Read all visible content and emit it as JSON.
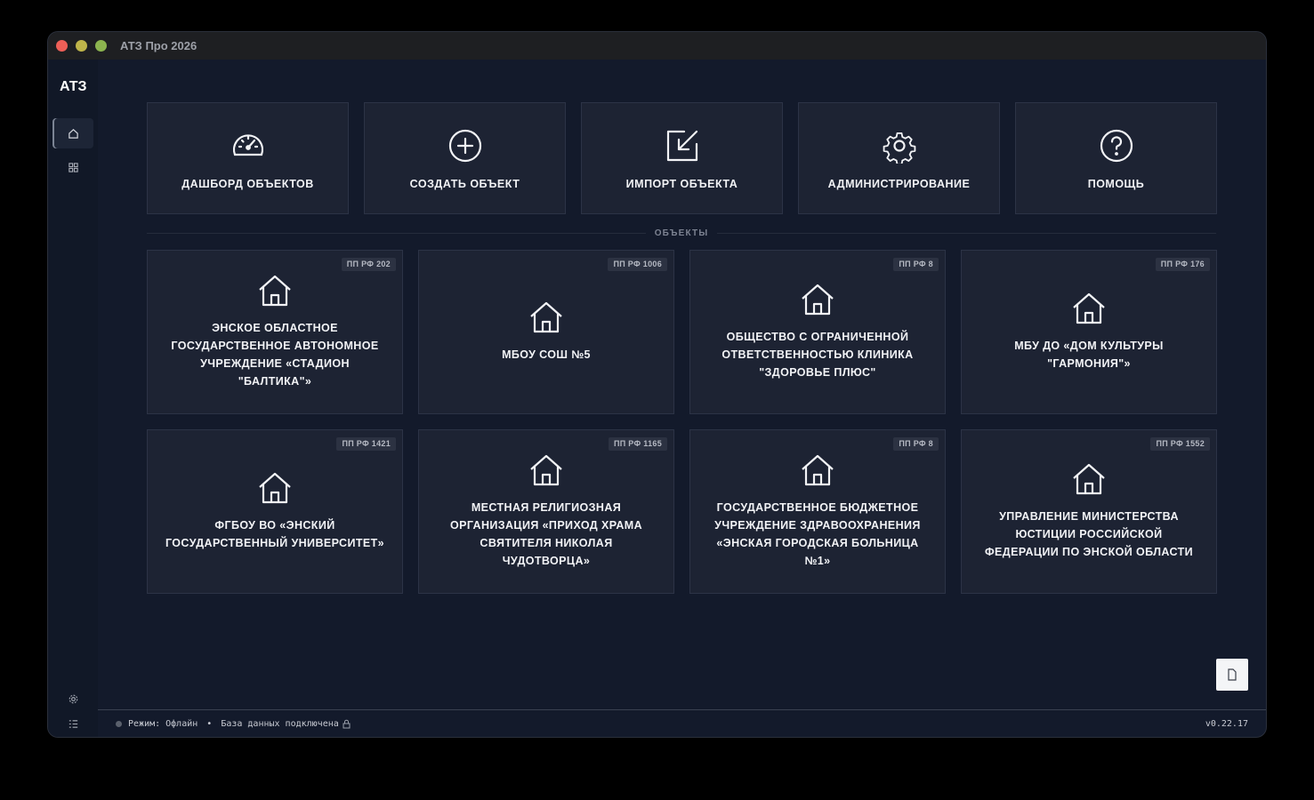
{
  "window": {
    "title": "АТЗ Про 2026"
  },
  "sidebar": {
    "logo": "АТЗ",
    "items": [
      {
        "icon": "home-icon"
      },
      {
        "icon": "grid-icon"
      }
    ],
    "bottom": [
      {
        "icon": "gear-icon"
      },
      {
        "icon": "list-icon"
      }
    ]
  },
  "actions": [
    {
      "label": "ДАШБОРД ОБЪЕКТОВ",
      "icon": "speedometer-icon"
    },
    {
      "label": "СОЗДАТЬ ОБЪЕКТ",
      "icon": "plus-circle-icon"
    },
    {
      "label": "ИМПОРТ ОБЪЕКТА",
      "icon": "import-icon"
    },
    {
      "label": "АДМИНИСТРИРОВАНИЕ",
      "icon": "gear-icon"
    },
    {
      "label": "ПОМОЩЬ",
      "icon": "help-icon"
    }
  ],
  "section_title": "ОБЪЕКТЫ",
  "objects": [
    {
      "badge": "ПП РФ 202",
      "name": "ЭНСКОЕ ОБЛАСТНОЕ ГОСУДАРСТВЕННОЕ АВТОНОМНОЕ УЧРЕЖДЕНИЕ «СТАДИОН \"БАЛТИКА\"»"
    },
    {
      "badge": "ПП РФ 1006",
      "name": "МБОУ СОШ №5"
    },
    {
      "badge": "ПП РФ 8",
      "name": "ОБЩЕСТВО С ОГРАНИЧЕННОЙ ОТВЕТСТВЕННОСТЬЮ КЛИНИКА \"ЗДОРОВЬЕ ПЛЮС\""
    },
    {
      "badge": "ПП РФ 176",
      "name": "МБУ ДО «ДОМ КУЛЬТУРЫ \"ГАРМОНИЯ\"»"
    },
    {
      "badge": "ПП РФ 1421",
      "name": "ФГБОУ ВО «ЭНСКИЙ ГОСУДАРСТВЕННЫЙ УНИВЕРСИТЕТ»"
    },
    {
      "badge": "ПП РФ 1165",
      "name": "МЕСТНАЯ РЕЛИГИОЗНАЯ ОРГАНИЗАЦИЯ «ПРИХОД ХРАМА СВЯТИТЕЛЯ НИКОЛАЯ ЧУДОТВОРЦА»"
    },
    {
      "badge": "ПП РФ 8",
      "name": "ГОСУДАРСТВЕННОЕ БЮДЖЕТНОЕ УЧРЕЖДЕНИЕ ЗДРАВООХРАНЕНИЯ «ЭНСКАЯ ГОРОДСКАЯ БОЛЬНИЦА №1»"
    },
    {
      "badge": "ПП РФ 1552",
      "name": "УПРАВЛЕНИЕ МИНИСТЕРСТВА ЮСТИЦИИ РОССИЙСКОЙ ФЕДЕРАЦИИ ПО ЭНСКОЙ ОБЛАСТИ"
    }
  ],
  "status": {
    "mode": "Режим: Офлайн",
    "separator": "•",
    "db": "База данных подключена",
    "version": "v0.22.17"
  }
}
